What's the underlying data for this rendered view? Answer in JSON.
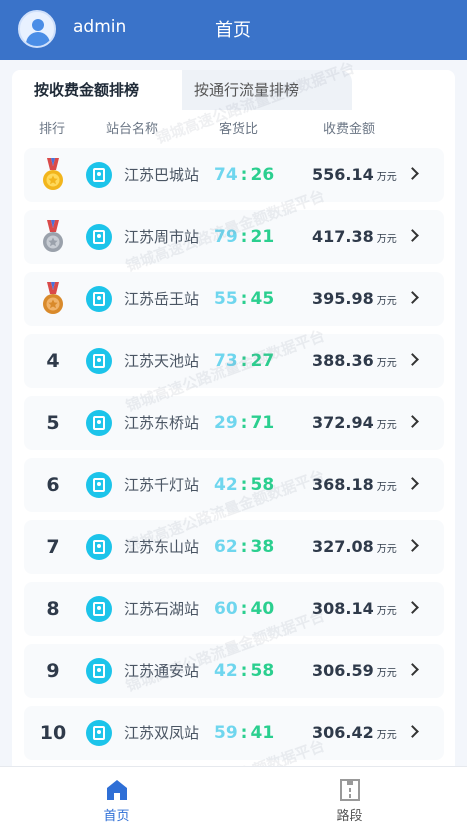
{
  "header": {
    "username": "admin",
    "page_title": "首页"
  },
  "tabs": [
    {
      "label": "按收费金额排榜",
      "active": true
    },
    {
      "label": "按通行流量排榜",
      "active": false
    }
  ],
  "columns": {
    "rank": "排行",
    "station": "站台名称",
    "ratio": "客货比",
    "amount": "收费金额"
  },
  "unit": "万元",
  "rows": [
    {
      "rank": "",
      "medal": "gold",
      "station": "江苏巴城站",
      "passenger": "74",
      "freight": "26",
      "amount": "556.14"
    },
    {
      "rank": "",
      "medal": "silver",
      "station": "江苏周市站",
      "passenger": "79",
      "freight": "21",
      "amount": "417.38"
    },
    {
      "rank": "",
      "medal": "bronze",
      "station": "江苏岳王站",
      "passenger": "55",
      "freight": "45",
      "amount": "395.98"
    },
    {
      "rank": "4",
      "medal": "",
      "station": "江苏天池站",
      "passenger": "73",
      "freight": "27",
      "amount": "388.36"
    },
    {
      "rank": "5",
      "medal": "",
      "station": "江苏东桥站",
      "passenger": "29",
      "freight": "71",
      "amount": "372.94"
    },
    {
      "rank": "6",
      "medal": "",
      "station": "江苏千灯站",
      "passenger": "42",
      "freight": "58",
      "amount": "368.18"
    },
    {
      "rank": "7",
      "medal": "",
      "station": "江苏东山站",
      "passenger": "62",
      "freight": "38",
      "amount": "327.08"
    },
    {
      "rank": "8",
      "medal": "",
      "station": "江苏石湖站",
      "passenger": "60",
      "freight": "40",
      "amount": "308.14"
    },
    {
      "rank": "9",
      "medal": "",
      "station": "江苏通安站",
      "passenger": "42",
      "freight": "58",
      "amount": "306.59"
    },
    {
      "rank": "10",
      "medal": "",
      "station": "江苏双凤站",
      "passenger": "59",
      "freight": "41",
      "amount": "306.42"
    }
  ],
  "bottom_nav": [
    {
      "label": "首页",
      "icon": "home-icon",
      "active": true
    },
    {
      "label": "路段",
      "icon": "route-icon",
      "active": false
    }
  ],
  "watermark": "锦城高速公路流量金额数据平台",
  "colors": {
    "header_bg": "#3a73c9",
    "ratio_passenger": "#6fd6ee",
    "ratio_freight": "#2bcf8f",
    "nav_active": "#2f6fd6",
    "station_icon": "#1cc4ea"
  }
}
